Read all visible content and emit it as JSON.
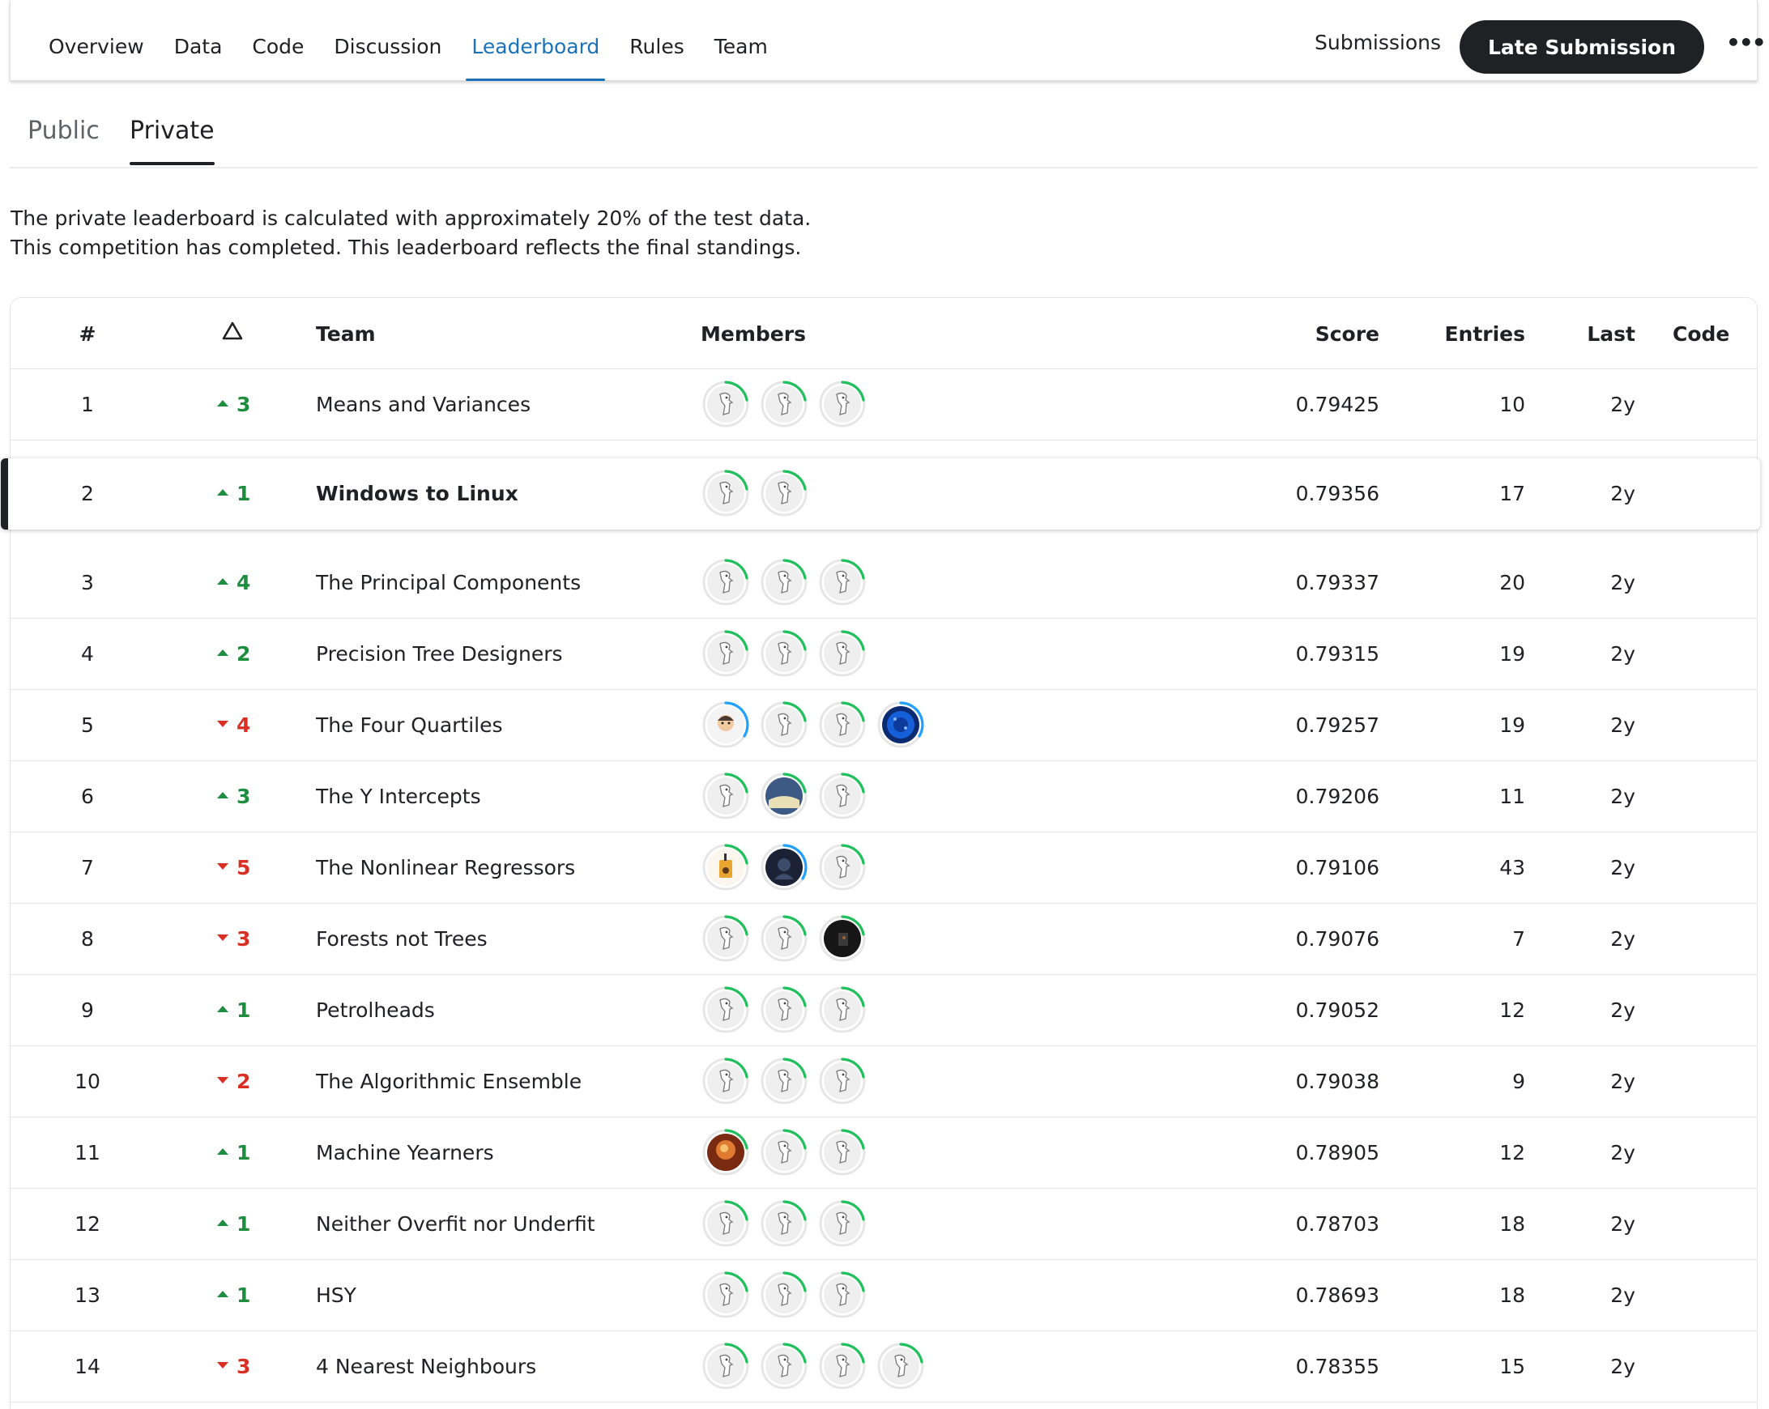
{
  "nav": {
    "items": [
      "Overview",
      "Data",
      "Code",
      "Discussion",
      "Leaderboard",
      "Rules",
      "Team"
    ],
    "active": "Leaderboard",
    "submissions": "Submissions",
    "late_submission": "Late Submission",
    "more_icon": "ellipsis-icon"
  },
  "subtabs": {
    "public": "Public",
    "private": "Private",
    "active": "Private"
  },
  "description": {
    "line1": "The private leaderboard is calculated with approximately 20% of the test data.",
    "line2": "This competition has completed. This leaderboard reflects the final standings."
  },
  "table": {
    "headers": {
      "rank": "#",
      "change_icon": "delta-triangle-icon",
      "team": "Team",
      "members": "Members",
      "score": "Score",
      "entries": "Entries",
      "last": "Last",
      "code": "Code"
    },
    "rows": [
      {
        "rank": "1",
        "dir": "up",
        "change": "3",
        "team": "Means and Variances",
        "members": [
          "default",
          "default",
          "default"
        ],
        "score": "0.79425",
        "entries": "10",
        "last": "2y",
        "highlight": false
      },
      {
        "rank": "2",
        "dir": "up",
        "change": "1",
        "team": "Windows to Linux",
        "members": [
          "default",
          "default"
        ],
        "score": "0.79356",
        "entries": "17",
        "last": "2y",
        "highlight": true
      },
      {
        "rank": "3",
        "dir": "up",
        "change": "4",
        "team": "The Principal Components",
        "members": [
          "default",
          "default",
          "default"
        ],
        "score": "0.79337",
        "entries": "20",
        "last": "2y",
        "highlight": false
      },
      {
        "rank": "4",
        "dir": "up",
        "change": "2",
        "team": "Precision Tree Designers",
        "members": [
          "default",
          "default",
          "default"
        ],
        "score": "0.79315",
        "entries": "19",
        "last": "2y",
        "highlight": false
      },
      {
        "rank": "5",
        "dir": "down",
        "change": "4",
        "team": "The Four Quartiles",
        "members": [
          "person",
          "default",
          "default",
          "blue-galaxy"
        ],
        "score": "0.79257",
        "entries": "19",
        "last": "2y",
        "highlight": false
      },
      {
        "rank": "6",
        "dir": "up",
        "change": "3",
        "team": "The Y Intercepts",
        "members": [
          "default",
          "landscape",
          "default"
        ],
        "score": "0.79206",
        "entries": "11",
        "last": "2y",
        "highlight": false
      },
      {
        "rank": "7",
        "dir": "down",
        "change": "5",
        "team": "The Nonlinear Regressors",
        "members": [
          "drink",
          "dark-figure",
          "default"
        ],
        "score": "0.79106",
        "entries": "43",
        "last": "2y",
        "highlight": false
      },
      {
        "rank": "8",
        "dir": "down",
        "change": "3",
        "team": "Forests not Trees",
        "members": [
          "default",
          "default",
          "dark-scene"
        ],
        "score": "0.79076",
        "entries": "7",
        "last": "2y",
        "highlight": false
      },
      {
        "rank": "9",
        "dir": "up",
        "change": "1",
        "team": "Petrolheads",
        "members": [
          "default",
          "default",
          "default"
        ],
        "score": "0.79052",
        "entries": "12",
        "last": "2y",
        "highlight": false
      },
      {
        "rank": "10",
        "dir": "down",
        "change": "2",
        "team": "The Algorithmic Ensemble",
        "members": [
          "default",
          "default",
          "default"
        ],
        "score": "0.79038",
        "entries": "9",
        "last": "2y",
        "highlight": false
      },
      {
        "rank": "11",
        "dir": "up",
        "change": "1",
        "team": "Machine Yearners",
        "members": [
          "orange-photo",
          "default",
          "default"
        ],
        "score": "0.78905",
        "entries": "12",
        "last": "2y",
        "highlight": false
      },
      {
        "rank": "12",
        "dir": "up",
        "change": "1",
        "team": "Neither Overfit nor Underfit",
        "members": [
          "default",
          "default",
          "default"
        ],
        "score": "0.78703",
        "entries": "18",
        "last": "2y",
        "highlight": false
      },
      {
        "rank": "13",
        "dir": "up",
        "change": "1",
        "team": "HSY",
        "members": [
          "default",
          "default",
          "default"
        ],
        "score": "0.78693",
        "entries": "18",
        "last": "2y",
        "highlight": false
      },
      {
        "rank": "14",
        "dir": "down",
        "change": "3",
        "team": "4 Nearest Neighbours",
        "members": [
          "default",
          "default",
          "default",
          "default"
        ],
        "score": "0.78355",
        "entries": "15",
        "last": "2y",
        "highlight": false
      }
    ]
  },
  "colors": {
    "accent": "#1a73b8",
    "up": "#1e8e3e",
    "down": "#d93025",
    "ring_green": "#20c05c",
    "ring_blue": "#20a0ff"
  }
}
